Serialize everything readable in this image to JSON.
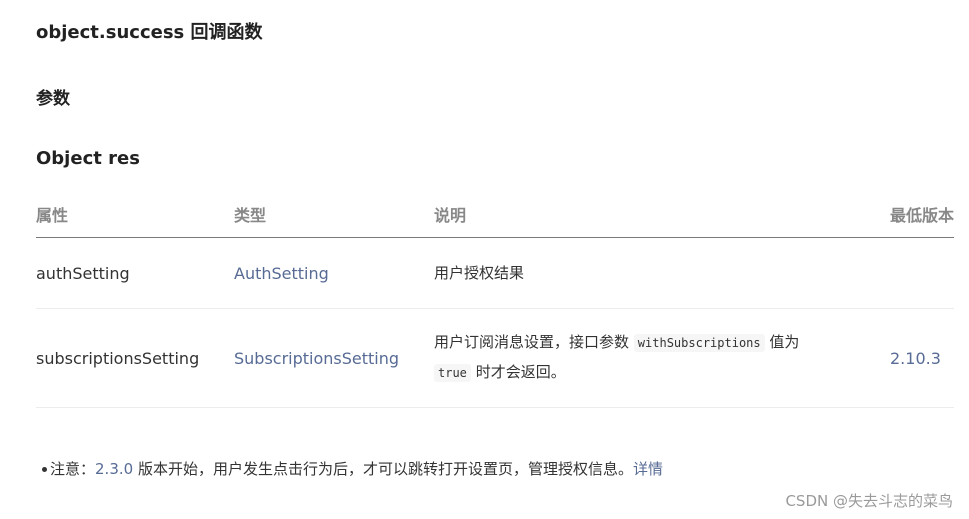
{
  "heading_callback": "object.success 回调函数",
  "heading_params": "参数",
  "heading_object": "Object res",
  "table": {
    "headers": [
      "属性",
      "类型",
      "说明",
      "最低版本"
    ],
    "rows": [
      {
        "property": "authSetting",
        "type": "AuthSetting",
        "desc": "用户授权结果",
        "version": ""
      },
      {
        "property": "subscriptionsSetting",
        "type": "SubscriptionsSetting",
        "desc_pre": "用户订阅消息设置，接口参数",
        "desc_code1": "withSubscriptions",
        "desc_mid": "值为",
        "desc_code2": "true",
        "desc_post": "时才会返回。",
        "version": "2.10.3"
      }
    ]
  },
  "note": {
    "prefix": "注意：",
    "version_link": "2.3.0",
    "text": "版本开始，用户发生点击行为后，才可以跳转打开设置页，管理授权信息。",
    "detail_link": "详情"
  },
  "watermark": "CSDN @失去斗志的菜鸟"
}
